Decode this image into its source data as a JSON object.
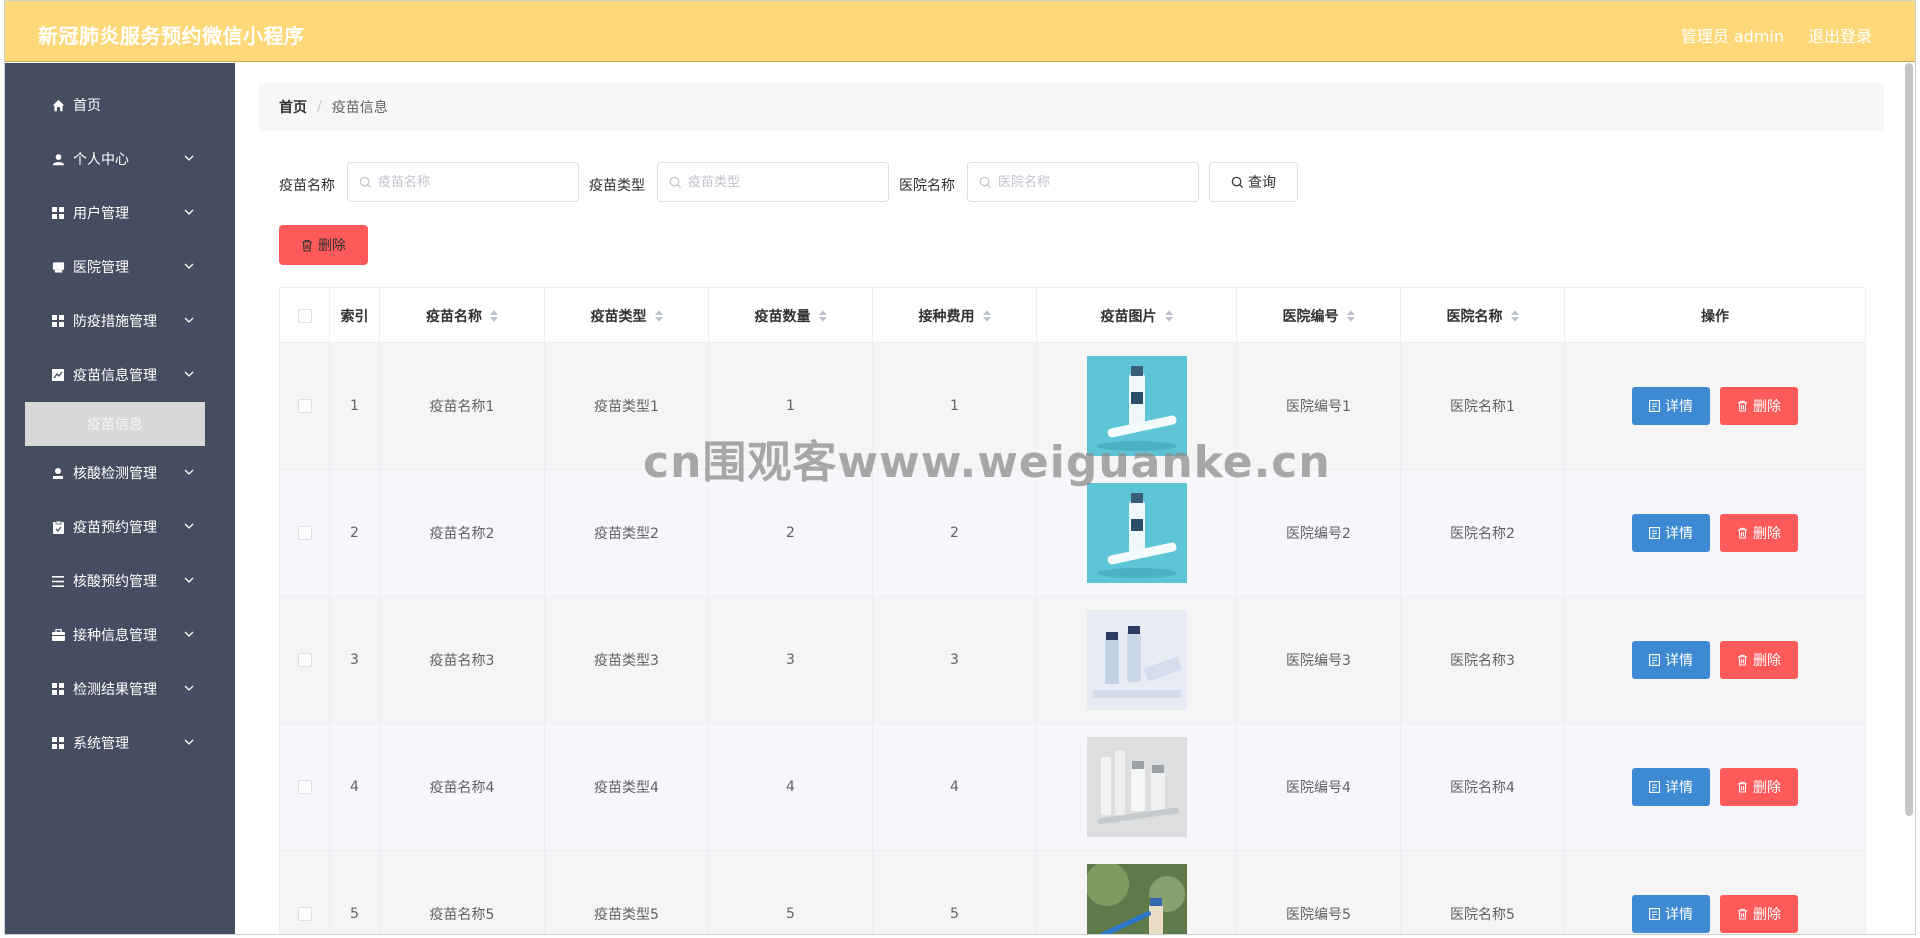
{
  "header": {
    "title": "新冠肺炎服务预约微信小程序",
    "admin": "管理员 admin",
    "logout": "退出登录"
  },
  "sidebar": {
    "items": [
      {
        "label": "首页",
        "icon": "home-icon"
      },
      {
        "label": "个人中心",
        "icon": "user-icon"
      },
      {
        "label": "用户管理",
        "icon": "grid-icon"
      },
      {
        "label": "医院管理",
        "icon": "hospital-icon"
      },
      {
        "label": "防疫措施管理",
        "icon": "grid-icon"
      },
      {
        "label": "疫苗信息管理",
        "icon": "chart-icon"
      },
      {
        "label": "核酸检测管理",
        "icon": "person-icon"
      },
      {
        "label": "疫苗预约管理",
        "icon": "clipboard-icon"
      },
      {
        "label": "核酸预约管理",
        "icon": "list-icon"
      },
      {
        "label": "接种信息管理",
        "icon": "briefcase-icon"
      },
      {
        "label": "检测结果管理",
        "icon": "grid-icon"
      },
      {
        "label": "系统管理",
        "icon": "grid-icon"
      }
    ],
    "active_sub": "疫苗信息"
  },
  "breadcrumb": {
    "home": "首页",
    "current": "疫苗信息"
  },
  "filters": [
    {
      "label": "疫苗名称",
      "placeholder": "疫苗名称",
      "value": ""
    },
    {
      "label": "疫苗类型",
      "placeholder": "疫苗类型",
      "value": ""
    },
    {
      "label": "医院名称",
      "placeholder": "医院名称",
      "value": ""
    }
  ],
  "buttons": {
    "query": "查询",
    "delete": "删除"
  },
  "table": {
    "headers": [
      "索引",
      "疫苗名称",
      "疫苗类型",
      "疫苗数量",
      "接种费用",
      "疫苗图片",
      "医院编号",
      "医院名称",
      "操作"
    ],
    "rows": [
      {
        "index": "1",
        "name": "疫苗名称1",
        "type": "疫苗类型1",
        "count": "1",
        "fee": "1",
        "hosp_no": "医院编号1",
        "hosp_name": "医院名称1"
      },
      {
        "index": "2",
        "name": "疫苗名称2",
        "type": "疫苗类型2",
        "count": "2",
        "fee": "2",
        "hosp_no": "医院编号2",
        "hosp_name": "医院名称2"
      },
      {
        "index": "3",
        "name": "疫苗名称3",
        "type": "疫苗类型3",
        "count": "3",
        "fee": "3",
        "hosp_no": "医院编号3",
        "hosp_name": "医院名称3"
      },
      {
        "index": "4",
        "name": "疫苗名称4",
        "type": "疫苗类型4",
        "count": "4",
        "fee": "4",
        "hosp_no": "医院编号4",
        "hosp_name": "医院名称4"
      },
      {
        "index": "5",
        "name": "疫苗名称5",
        "type": "疫苗类型5",
        "count": "5",
        "fee": "5",
        "hosp_no": "医院编号5",
        "hosp_name": "医院名称5"
      }
    ],
    "row_buttons": {
      "detail": "详情",
      "delete": "删除"
    }
  },
  "watermark": "cn围观客www.weiguanke.cn",
  "colors": {
    "header": "#ffd87a",
    "sidebar": "#454d60",
    "primary": "#3d8ad2",
    "danger": "#ff5a5a"
  }
}
